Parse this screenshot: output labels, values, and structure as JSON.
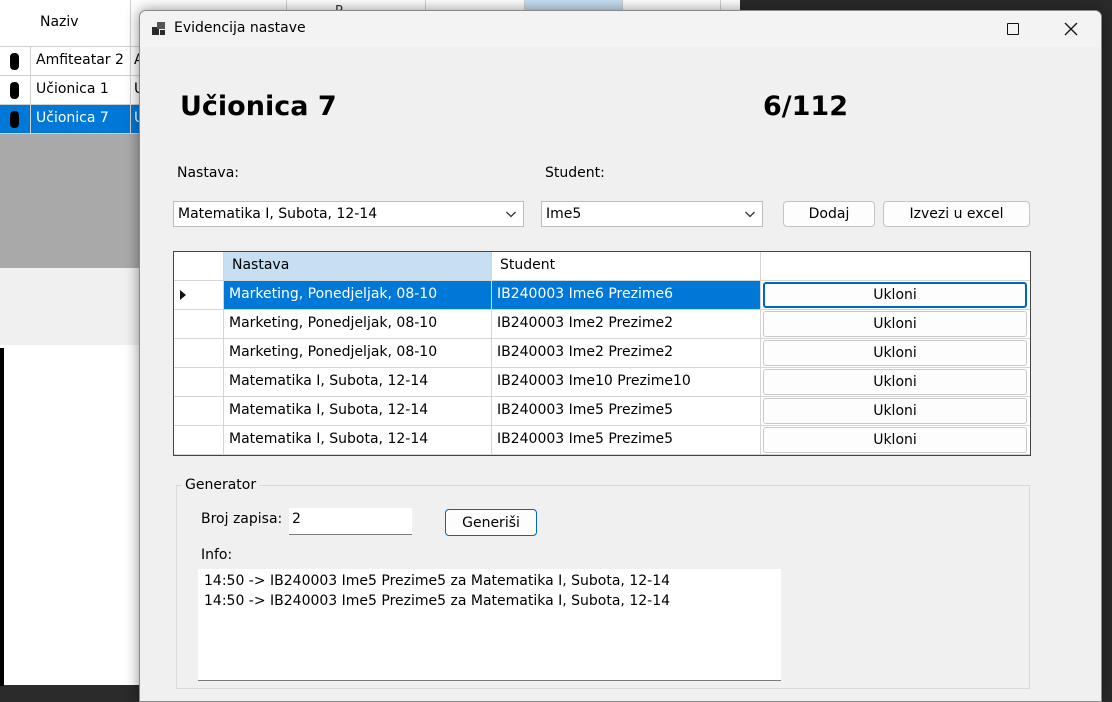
{
  "background_window": {
    "header": {
      "naziv": "Naziv",
      "partial": "P..."
    },
    "rows": [
      {
        "name": "Amfiteatar 2",
        "col2": "A"
      },
      {
        "name": "Učionica 1",
        "col2": "U"
      },
      {
        "name": "Učionica 7",
        "col2": "U"
      }
    ]
  },
  "window": {
    "title": "Evidencija nastave"
  },
  "header": {
    "room": "Učionica 7",
    "count": "6/112"
  },
  "form": {
    "nastava_label": "Nastava:",
    "student_label": "Student:",
    "nastava_value": "Matematika I, Subota, 12-14",
    "student_value": "Ime5",
    "dodaj_label": "Dodaj",
    "excel_label": "Izvezi u excel"
  },
  "grid": {
    "columns": [
      "Nastava",
      "Student",
      ""
    ],
    "rows": [
      {
        "nastava": "Marketing, Ponedjeljak, 08-10",
        "student": "IB240003 Ime6 Prezime6",
        "action": "Ukloni"
      },
      {
        "nastava": "Marketing, Ponedjeljak, 08-10",
        "student": "IB240003 Ime2 Prezime2",
        "action": "Ukloni"
      },
      {
        "nastava": "Marketing, Ponedjeljak, 08-10",
        "student": "IB240003 Ime2 Prezime2",
        "action": "Ukloni"
      },
      {
        "nastava": "Matematika I, Subota, 12-14",
        "student": "IB240003 Ime10 Prezime10",
        "action": "Ukloni"
      },
      {
        "nastava": "Matematika I, Subota, 12-14",
        "student": "IB240003 Ime5 Prezime5",
        "action": "Ukloni"
      },
      {
        "nastava": "Matematika I, Subota, 12-14",
        "student": "IB240003 Ime5 Prezime5",
        "action": "Ukloni"
      }
    ]
  },
  "generator": {
    "title": "Generator",
    "broj_label": "Broj zapisa:",
    "broj_value": "2",
    "button_label": "Generiši",
    "info_label": "Info:",
    "info_lines": [
      "14:50 -> IB240003 Ime5 Prezime5 za  Matematika I, Subota, 12-14",
      "14:50 -> IB240003 Ime5 Prezime5 za  Matematika I, Subota, 12-14"
    ]
  }
}
